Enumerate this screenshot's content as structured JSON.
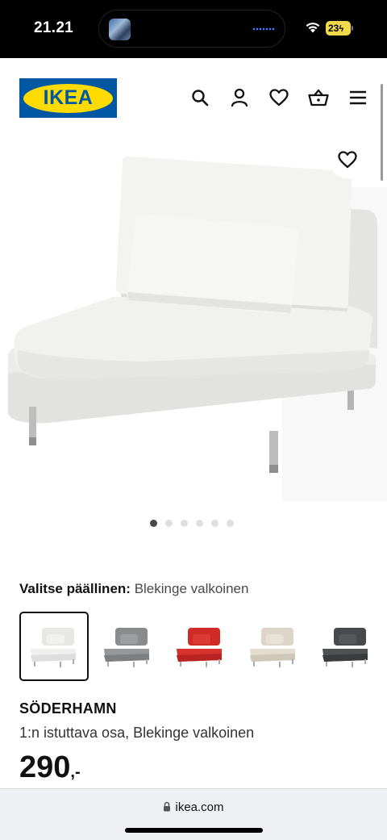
{
  "status_bar": {
    "time": "21.21",
    "battery": "23"
  },
  "header": {
    "logo_text": "IKEA",
    "icons": [
      "search-icon",
      "user-icon",
      "heart-icon",
      "basket-icon",
      "menu-icon"
    ]
  },
  "product": {
    "image_alt": "SÖDERHAMN 1:n istuttava osa",
    "carousel": {
      "total": 6,
      "active": 1
    },
    "cover_label": "Valitse päällinen:",
    "cover_value": "Blekinge valkoinen",
    "swatches": [
      {
        "color": "#eeeeec",
        "selected": true
      },
      {
        "color": "#8e8f91",
        "selected": false
      },
      {
        "color": "#d3302c",
        "selected": false
      },
      {
        "color": "#e1dbcd",
        "selected": false
      },
      {
        "color": "#4a4c50",
        "selected": false
      }
    ],
    "name": "SÖDERHAMN",
    "description": "1:n istuttava osa, Blekinge valkoinen",
    "price": "290",
    "price_suffix": ",-"
  },
  "browser": {
    "url": "ikea.com"
  },
  "colors": {
    "ikea_blue": "#0058a3",
    "ikea_yellow": "#ffdb00",
    "battery": "#f2d84b"
  }
}
